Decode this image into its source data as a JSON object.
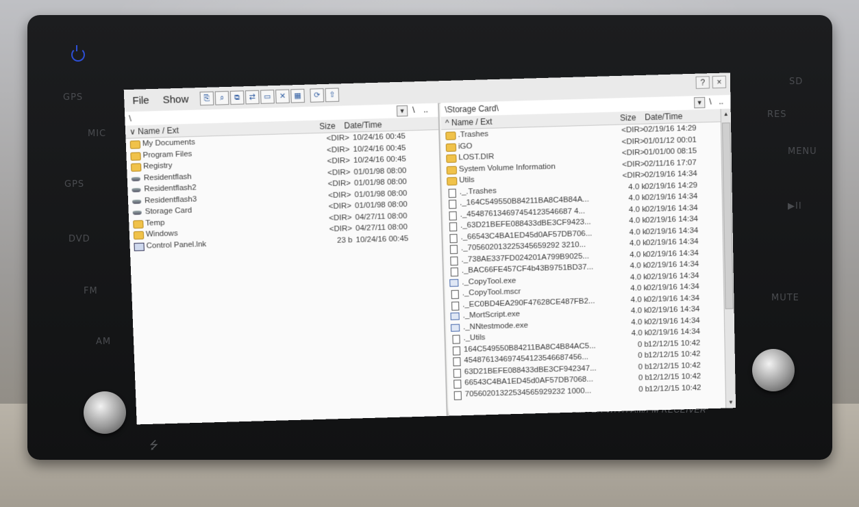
{
  "device": {
    "side_left": [
      "GPS",
      "MIC",
      "GPS",
      "DVD",
      "FM",
      "AM"
    ],
    "side_right": [
      "SD",
      "RES",
      "MENU",
      "▶II",
      "MUTE"
    ],
    "brand_line": "DVD/VCD/CD/MP4/MP3 PLAYER WITH AM/FM RECEIVER",
    "usb_symbol": "⭍"
  },
  "menu": {
    "file": "File",
    "show": "Show"
  },
  "window": {
    "help": "?",
    "close": "×"
  },
  "left": {
    "path": "\\",
    "up": "\\",
    "parent": "..",
    "col_name": "∨ Name / Ext",
    "col_size": "Size",
    "col_date": "Date/Time",
    "rows": [
      {
        "name": "My Documents",
        "size": "<DIR>",
        "date": "10/24/16 00:45",
        "icon": "folder"
      },
      {
        "name": "Program Files",
        "size": "<DIR>",
        "date": "10/24/16 00:45",
        "icon": "folder"
      },
      {
        "name": "Registry",
        "size": "<DIR>",
        "date": "10/24/16 00:45",
        "icon": "folder"
      },
      {
        "name": "Residentflash",
        "size": "<DIR>",
        "date": "01/01/98 08:00",
        "icon": "drive"
      },
      {
        "name": "Residentflash2",
        "size": "<DIR>",
        "date": "01/01/98 08:00",
        "icon": "drive"
      },
      {
        "name": "Residentflash3",
        "size": "<DIR>",
        "date": "01/01/98 08:00",
        "icon": "drive"
      },
      {
        "name": "Storage Card",
        "size": "<DIR>",
        "date": "01/01/98 08:00",
        "icon": "drive"
      },
      {
        "name": "Temp",
        "size": "<DIR>",
        "date": "04/27/11 08:00",
        "icon": "folder"
      },
      {
        "name": "Windows",
        "size": "<DIR>",
        "date": "04/27/11 08:00",
        "icon": "folder"
      },
      {
        "name": "Control Panel.lnk",
        "size": "23 b",
        "date": "10/24/16 00:45",
        "icon": "lnk"
      }
    ]
  },
  "right": {
    "path": "\\Storage Card\\",
    "up": "\\",
    "parent": "..",
    "col_name": "^ Name / Ext",
    "col_size": "Size",
    "col_date": "Date/Time",
    "rows": [
      {
        "name": ".Trashes",
        "size": "<DIR>",
        "date": "02/19/16 14:29",
        "icon": "folder"
      },
      {
        "name": "iGO",
        "size": "<DIR>",
        "date": "01/01/12 00:01",
        "icon": "folder"
      },
      {
        "name": "LOST.DIR",
        "size": "<DIR>",
        "date": "01/01/00 08:15",
        "icon": "folder"
      },
      {
        "name": "System Volume Information",
        "size": "<DIR>",
        "date": "02/11/16 17:07",
        "icon": "folder"
      },
      {
        "name": "Utils",
        "size": "<DIR>",
        "date": "02/19/16 14:34",
        "icon": "folder"
      },
      {
        "name": "._.Trashes",
        "size": "4.0 k",
        "date": "02/19/16 14:29",
        "icon": "file"
      },
      {
        "name": "._164C549550B84211BA8C4B84A...",
        "size": "4.0 k",
        "date": "02/19/16 14:34",
        "icon": "file"
      },
      {
        "name": "._454876134697454123546687 4...",
        "size": "4.0 k",
        "date": "02/19/16 14:34",
        "icon": "file"
      },
      {
        "name": "._63D21BEFE088433dBE3CF9423...",
        "size": "4.0 k",
        "date": "02/19/16 14:34",
        "icon": "file"
      },
      {
        "name": "._66543C4BA1ED45d0AF57DB706...",
        "size": "4.0 k",
        "date": "02/19/16 14:34",
        "icon": "file"
      },
      {
        "name": "._705602013225345659292 3210...",
        "size": "4.0 k",
        "date": "02/19/16 14:34",
        "icon": "file"
      },
      {
        "name": "._738AE337FD024201A799B9025...",
        "size": "4.0 k",
        "date": "02/19/16 14:34",
        "icon": "file"
      },
      {
        "name": "._BAC66FE457CF4b43B9751BD37...",
        "size": "4.0 k",
        "date": "02/19/16 14:34",
        "icon": "file"
      },
      {
        "name": "._CopyTool.exe",
        "size": "4.0 k",
        "date": "02/19/16 14:34",
        "icon": "exe"
      },
      {
        "name": "._CopyTool.mscr",
        "size": "4.0 k",
        "date": "02/19/16 14:34",
        "icon": "file"
      },
      {
        "name": "._EC0BD4EA290F47628CE487FB2...",
        "size": "4.0 k",
        "date": "02/19/16 14:34",
        "icon": "file"
      },
      {
        "name": "._MortScript.exe",
        "size": "4.0 k",
        "date": "02/19/16 14:34",
        "icon": "exe"
      },
      {
        "name": "._NNtestmode.exe",
        "size": "4.0 k",
        "date": "02/19/16 14:34",
        "icon": "exe"
      },
      {
        "name": "._Utils",
        "size": "4.0 k",
        "date": "02/19/16 14:34",
        "icon": "file"
      },
      {
        "name": "164C549550B84211BA8C4B84AC5...",
        "size": "0 b",
        "date": "12/12/15 10:42",
        "icon": "file"
      },
      {
        "name": "454876134697454123546687456...",
        "size": "0 b",
        "date": "12/12/15 10:42",
        "icon": "file"
      },
      {
        "name": "63D21BEFE088433dBE3CF942347...",
        "size": "0 b",
        "date": "12/12/15 10:42",
        "icon": "file"
      },
      {
        "name": "66543C4BA1ED45d0AF57DB7068...",
        "size": "0 b",
        "date": "12/12/15 10:42",
        "icon": "file"
      },
      {
        "name": "70560201322534565929232 1000...",
        "size": "0 b",
        "date": "12/12/15 10:42",
        "icon": "file"
      }
    ]
  }
}
